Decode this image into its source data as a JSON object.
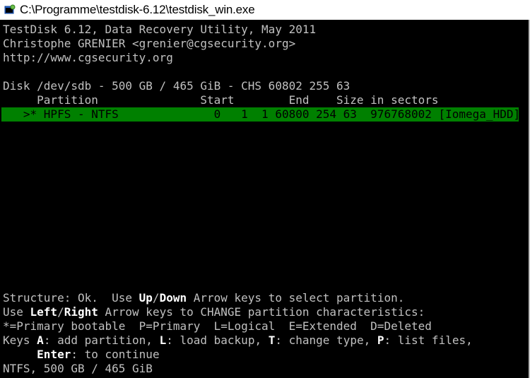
{
  "window": {
    "title": "C:\\Programme\\testdisk-6.12\\testdisk_win.exe"
  },
  "header": {
    "line1": "TestDisk 6.12, Data Recovery Utility, May 2011",
    "line2": "Christophe GRENIER <grenier@cgsecurity.org>",
    "line3": "http://www.cgsecurity.org"
  },
  "disk": {
    "info": "Disk /dev/sdb - 500 GB / 465 GiB - CHS 60802 255 63"
  },
  "table": {
    "header": "     Partition               Start        End    Size in sectors",
    "rows": [
      "   >* HPFS - NTFS              0   1  1 60800 254 63  976768002 [Iomega_HDD]"
    ]
  },
  "footer": {
    "l1_a": "Structure: Ok.  Use ",
    "l1_b": "Up",
    "l1_c": "/",
    "l1_d": "Down",
    "l1_e": " Arrow keys to select partition.",
    "l2_a": "Use ",
    "l2_b": "Left",
    "l2_c": "/",
    "l2_d": "Right",
    "l2_e": " Arrow keys to CHANGE partition characteristics:",
    "l3": "*=Primary bootable  P=Primary  L=Logical  E=Extended  D=Deleted",
    "l4_a": "Keys ",
    "l4_b": "A",
    "l4_c": ": add partition, ",
    "l4_d": "L",
    "l4_e": ": load backup, ",
    "l4_f": "T",
    "l4_g": ": change type, ",
    "l4_h": "P",
    "l4_i": ": list files,",
    "l5_a": "     ",
    "l5_b": "Enter",
    "l5_c": ": to continue",
    "l6": "NTFS, 500 GB / 465 GiB"
  },
  "colors": {
    "background": "#000000",
    "text": "#c0c0c0",
    "highlight_text": "#ffffff",
    "selection": "#008000"
  },
  "icons": {
    "app": "console-window-icon"
  }
}
